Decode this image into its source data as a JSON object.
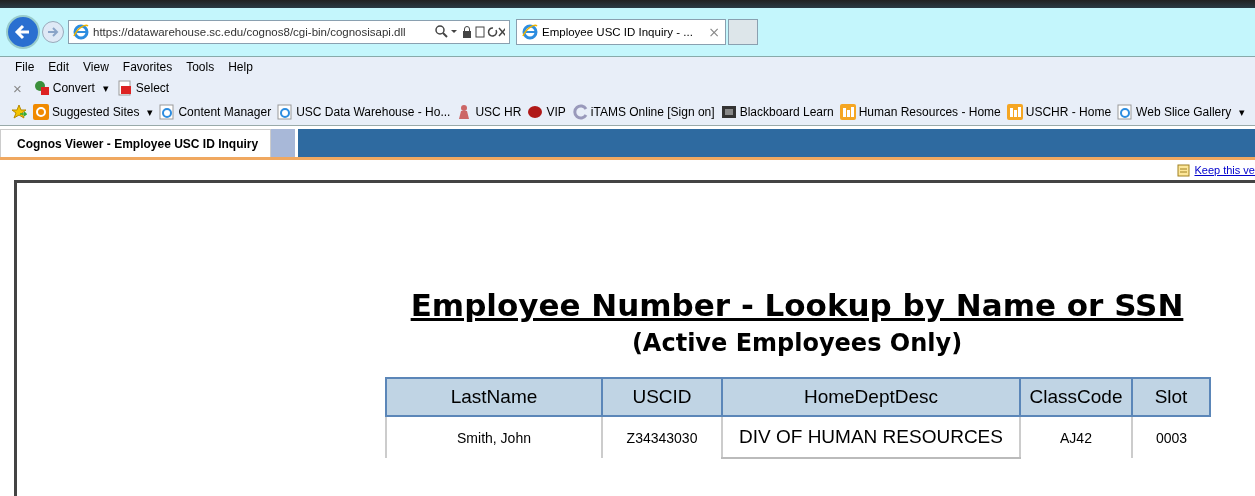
{
  "browser": {
    "url": "https://datawarehouse.sc.edu/cognos8/cgi-bin/cognosisapi.dll",
    "tab_title": "Employee USC ID Inquiry - ...",
    "tab_close": "×"
  },
  "menu": [
    "File",
    "Edit",
    "View",
    "Favorites",
    "Tools",
    "Help"
  ],
  "command_bar": {
    "close": "×",
    "items": [
      {
        "label": "Convert",
        "kind": "convert",
        "dropdown": "▾"
      },
      {
        "label": "Select",
        "kind": "select"
      }
    ]
  },
  "favorites": [
    {
      "label": "Suggested Sites",
      "kind": "bing",
      "dropdown": "▾"
    },
    {
      "label": "Content Manager",
      "kind": "ie"
    },
    {
      "label": "USC Data Warehouse - Ho...",
      "kind": "ie"
    },
    {
      "label": "USC HR",
      "kind": "figure"
    },
    {
      "label": "VIP",
      "kind": "vip"
    },
    {
      "label": "iTAMS Online [Sign on]",
      "kind": "itams"
    },
    {
      "label": "Blackboard Learn",
      "kind": "bb"
    },
    {
      "label": "Human Resources - Home",
      "kind": "grid"
    },
    {
      "label": "USCHR - Home",
      "kind": "grid"
    },
    {
      "label": "Web Slice Gallery",
      "kind": "ie",
      "dropdown": "▾"
    }
  ],
  "viewer": {
    "tab": "Cognos Viewer - Employee USC ID Inquiry",
    "keep_link": "Keep this ve"
  },
  "report": {
    "title": "Employee Number - Lookup by Name or SSN",
    "subtitle": "(Active Employees Only)",
    "table": {
      "columns": [
        "LastName",
        "USCID",
        "HomeDeptDesc",
        "ClassCode",
        "Slot"
      ],
      "rows": [
        [
          "Smith, John",
          "Z34343030",
          "DIV OF HUMAN RESOURCES",
          "AJ42",
          "0003"
        ]
      ]
    }
  }
}
